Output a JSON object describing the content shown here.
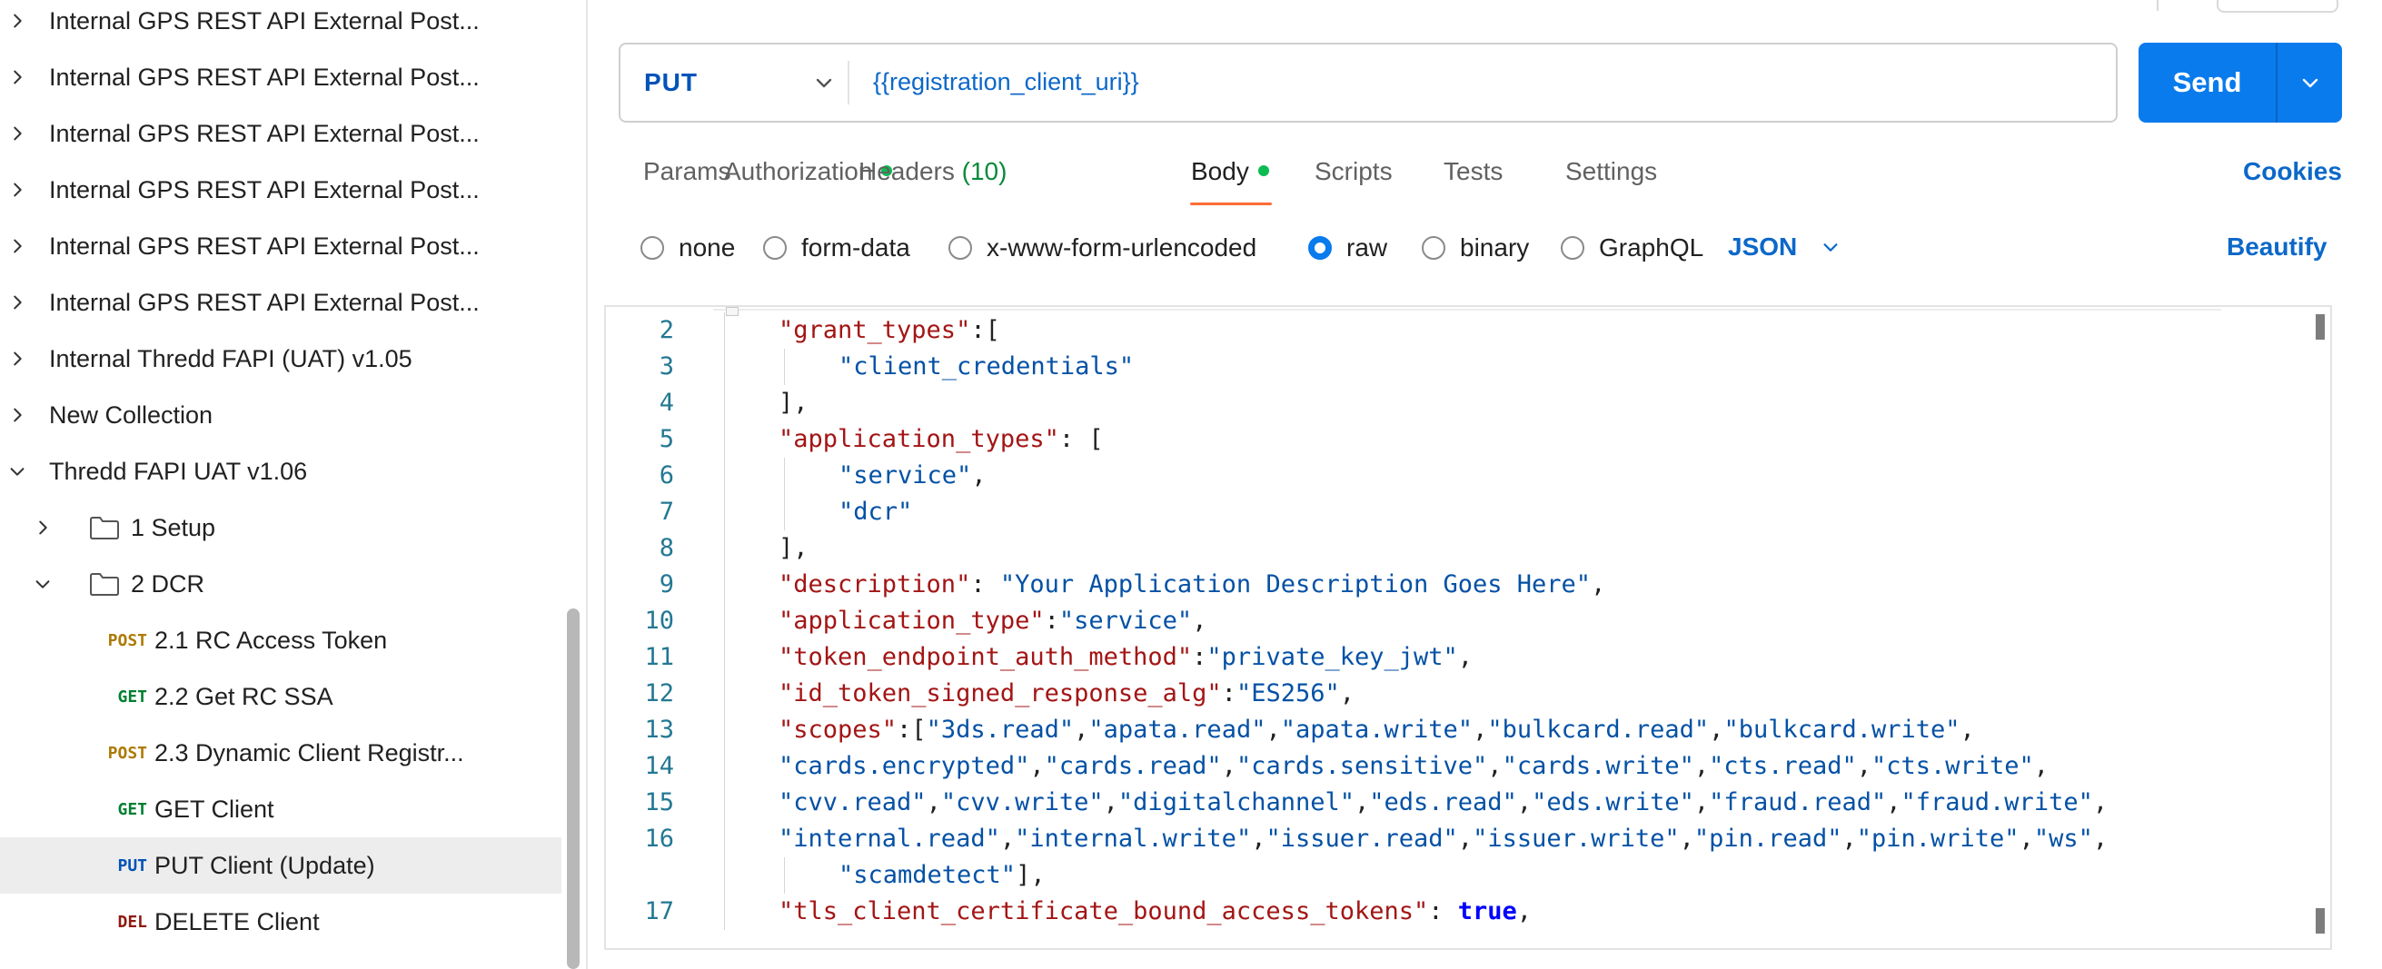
{
  "sidebar": {
    "items": [
      {
        "label": "Internal GPS REST API External Post...",
        "expanded": false
      },
      {
        "label": "Internal GPS REST API External Post...",
        "expanded": false
      },
      {
        "label": "Internal GPS REST API External Post...",
        "expanded": false
      },
      {
        "label": "Internal GPS REST API External Post...",
        "expanded": false
      },
      {
        "label": "Internal GPS REST API External Post...",
        "expanded": false
      },
      {
        "label": "Internal GPS REST API External Post...",
        "expanded": false
      },
      {
        "label": "Internal Thredd FAPI (UAT) v1.05",
        "expanded": false
      },
      {
        "label": "New Collection",
        "expanded": false
      },
      {
        "label": "Thredd FAPI UAT v1.06",
        "expanded": true
      }
    ],
    "folders": [
      {
        "label": "1 Setup",
        "expanded": false
      },
      {
        "label": "2 DCR",
        "expanded": true
      }
    ],
    "requests": [
      {
        "method": "POST",
        "label": "2.1 RC Access Token",
        "selected": false
      },
      {
        "method": "GET",
        "label": "2.2 Get RC SSA",
        "selected": false
      },
      {
        "method": "POST",
        "label": "2.3 Dynamic Client Registr...",
        "selected": false
      },
      {
        "method": "GET",
        "label": "GET Client",
        "selected": false
      },
      {
        "method": "PUT",
        "label": "PUT Client (Update)",
        "selected": true
      },
      {
        "method": "DEL",
        "label": "DELETE Client",
        "selected": false
      }
    ]
  },
  "request": {
    "method": "PUT",
    "url": "{{registration_client_uri}}",
    "send_label": "Send"
  },
  "tabs": {
    "params": "Params",
    "authorization": "Authorization",
    "headers": "Headers",
    "headers_count": "(10)",
    "body": "Body",
    "scripts": "Scripts",
    "tests": "Tests",
    "settings": "Settings",
    "active": "Body",
    "cookies": "Cookies"
  },
  "body_options": {
    "none": "none",
    "form_data": "form-data",
    "urlencoded": "x-www-form-urlencoded",
    "raw": "raw",
    "binary": "binary",
    "graphql": "GraphQL",
    "selected": "raw",
    "language": "JSON",
    "beautify": "Beautify"
  },
  "colors": {
    "accent": "#097bed",
    "active_tab_underline": "#ff6c37",
    "status_dot": "#0cbb52",
    "link": "#0c68c9"
  },
  "editor": {
    "lines": [
      {
        "n": "2",
        "indent": 1,
        "tokens": [
          {
            "t": "k",
            "v": "\"grant_types\""
          },
          {
            "t": "p",
            "v": ":["
          }
        ]
      },
      {
        "n": "3",
        "indent": 2,
        "tokens": [
          {
            "t": "s",
            "v": "\"client_credentials\""
          }
        ]
      },
      {
        "n": "4",
        "indent": 1,
        "tokens": [
          {
            "t": "p",
            "v": "],"
          }
        ]
      },
      {
        "n": "5",
        "indent": 1,
        "tokens": [
          {
            "t": "k",
            "v": "\"application_types\""
          },
          {
            "t": "p",
            "v": ": ["
          }
        ]
      },
      {
        "n": "6",
        "indent": 2,
        "tokens": [
          {
            "t": "s",
            "v": "\"service\""
          },
          {
            "t": "p",
            "v": ","
          }
        ]
      },
      {
        "n": "7",
        "indent": 2,
        "tokens": [
          {
            "t": "s",
            "v": "\"dcr\""
          }
        ]
      },
      {
        "n": "8",
        "indent": 1,
        "tokens": [
          {
            "t": "p",
            "v": "],"
          }
        ]
      },
      {
        "n": "9",
        "indent": 1,
        "tokens": [
          {
            "t": "k",
            "v": "\"description\""
          },
          {
            "t": "p",
            "v": ": "
          },
          {
            "t": "s",
            "v": "\"Your Application Description Goes Here\""
          },
          {
            "t": "p",
            "v": ","
          }
        ]
      },
      {
        "n": "10",
        "indent": 1,
        "tokens": [
          {
            "t": "k",
            "v": "\"application_type\""
          },
          {
            "t": "p",
            "v": ":"
          },
          {
            "t": "s",
            "v": "\"service\""
          },
          {
            "t": "p",
            "v": ","
          }
        ]
      },
      {
        "n": "11",
        "indent": 1,
        "tokens": [
          {
            "t": "k",
            "v": "\"token_endpoint_auth_method\""
          },
          {
            "t": "p",
            "v": ":"
          },
          {
            "t": "s",
            "v": "\"private_key_jwt\""
          },
          {
            "t": "p",
            "v": ","
          }
        ]
      },
      {
        "n": "12",
        "indent": 1,
        "tokens": [
          {
            "t": "k",
            "v": "\"id_token_signed_response_alg\""
          },
          {
            "t": "p",
            "v": ":"
          },
          {
            "t": "s",
            "v": "\"ES256\""
          },
          {
            "t": "p",
            "v": ","
          }
        ]
      },
      {
        "n": "13",
        "indent": 1,
        "tokens": [
          {
            "t": "k",
            "v": "\"scopes\""
          },
          {
            "t": "p",
            "v": ":["
          },
          {
            "t": "s",
            "v": "\"3ds.read\""
          },
          {
            "t": "p",
            "v": ","
          },
          {
            "t": "s",
            "v": "\"apata.read\""
          },
          {
            "t": "p",
            "v": ","
          },
          {
            "t": "s",
            "v": "\"apata.write\""
          },
          {
            "t": "p",
            "v": ","
          },
          {
            "t": "s",
            "v": "\"bulkcard.read\""
          },
          {
            "t": "p",
            "v": ","
          },
          {
            "t": "s",
            "v": "\"bulkcard.write\""
          },
          {
            "t": "p",
            "v": ","
          }
        ]
      },
      {
        "n": "14",
        "indent": 1,
        "tokens": [
          {
            "t": "s",
            "v": "\"cards.encrypted\""
          },
          {
            "t": "p",
            "v": ","
          },
          {
            "t": "s",
            "v": "\"cards.read\""
          },
          {
            "t": "p",
            "v": ","
          },
          {
            "t": "s",
            "v": "\"cards.sensitive\""
          },
          {
            "t": "p",
            "v": ","
          },
          {
            "t": "s",
            "v": "\"cards.write\""
          },
          {
            "t": "p",
            "v": ","
          },
          {
            "t": "s",
            "v": "\"cts.read\""
          },
          {
            "t": "p",
            "v": ","
          },
          {
            "t": "s",
            "v": "\"cts.write\""
          },
          {
            "t": "p",
            "v": ","
          }
        ]
      },
      {
        "n": "15",
        "indent": 1,
        "tokens": [
          {
            "t": "s",
            "v": "\"cvv.read\""
          },
          {
            "t": "p",
            "v": ","
          },
          {
            "t": "s",
            "v": "\"cvv.write\""
          },
          {
            "t": "p",
            "v": ","
          },
          {
            "t": "s",
            "v": "\"digitalchannel\""
          },
          {
            "t": "p",
            "v": ","
          },
          {
            "t": "s",
            "v": "\"eds.read\""
          },
          {
            "t": "p",
            "v": ","
          },
          {
            "t": "s",
            "v": "\"eds.write\""
          },
          {
            "t": "p",
            "v": ","
          },
          {
            "t": "s",
            "v": "\"fraud.read\""
          },
          {
            "t": "p",
            "v": ","
          },
          {
            "t": "s",
            "v": "\"fraud.write\""
          },
          {
            "t": "p",
            "v": ","
          }
        ]
      },
      {
        "n": "16",
        "indent": 1,
        "tokens": [
          {
            "t": "s",
            "v": "\"internal.read\""
          },
          {
            "t": "p",
            "v": ","
          },
          {
            "t": "s",
            "v": "\"internal.write\""
          },
          {
            "t": "p",
            "v": ","
          },
          {
            "t": "s",
            "v": "\"issuer.read\""
          },
          {
            "t": "p",
            "v": ","
          },
          {
            "t": "s",
            "v": "\"issuer.write\""
          },
          {
            "t": "p",
            "v": ","
          },
          {
            "t": "s",
            "v": "\"pin.read\""
          },
          {
            "t": "p",
            "v": ","
          },
          {
            "t": "s",
            "v": "\"pin.write\""
          },
          {
            "t": "p",
            "v": ","
          },
          {
            "t": "s",
            "v": "\"ws\""
          },
          {
            "t": "p",
            "v": ","
          }
        ]
      },
      {
        "n": "",
        "indent": 2,
        "tokens": [
          {
            "t": "s",
            "v": "\"scamdetect\""
          },
          {
            "t": "p",
            "v": "],"
          }
        ]
      },
      {
        "n": "17",
        "indent": 1,
        "tokens": [
          {
            "t": "k",
            "v": "\"tls_client_certificate_bound_access_tokens\""
          },
          {
            "t": "p",
            "v": ": "
          },
          {
            "t": "b",
            "v": "true"
          },
          {
            "t": "p",
            "v": ","
          }
        ]
      }
    ]
  }
}
